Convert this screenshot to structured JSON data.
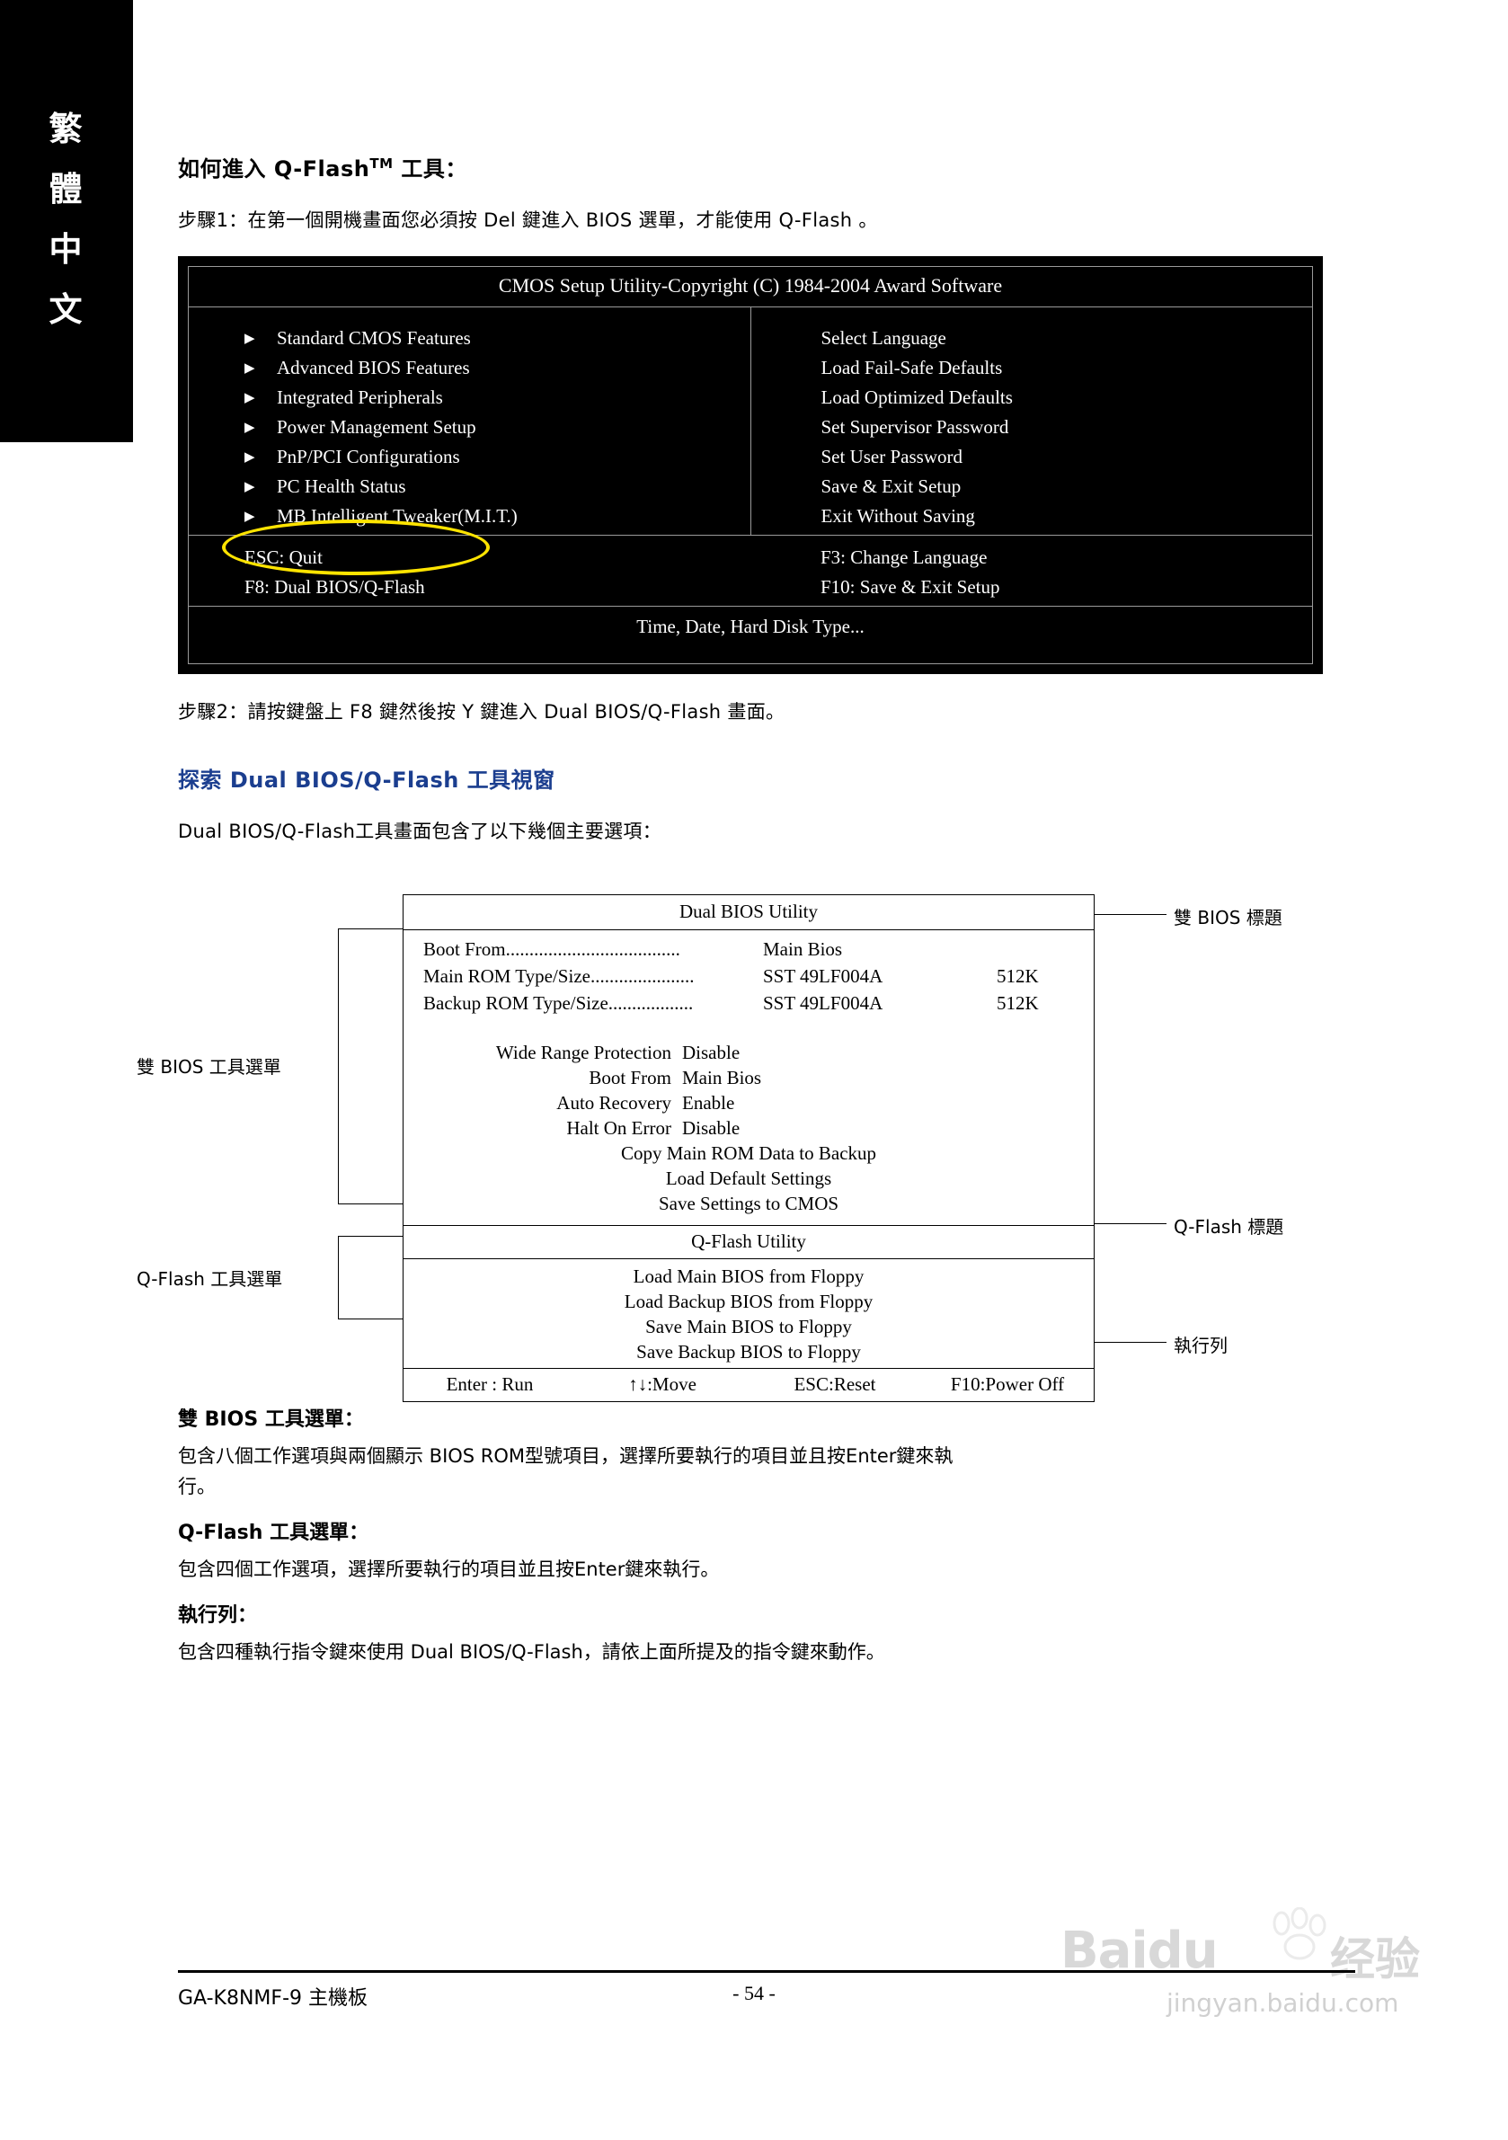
{
  "side_tab": {
    "chars": [
      "繁",
      "體",
      "中",
      "文"
    ]
  },
  "headings": {
    "how_to_enter": "如何進入 Q-Flash",
    "how_to_enter_sup": "TM",
    "how_to_enter_tail": " 工具：",
    "step1": "步驟1：在第一個開機畫面您必須按 Del 鍵進入 BIOS 選單，才能使用 Q-Flash 。",
    "step2": "步驟2：請按鍵盤上 F8 鍵然後按 Y 鍵進入 Dual BIOS/Q-Flash 畫面。",
    "explore": "探索 Dual BIOS/Q-Flash 工具視窗",
    "explore_desc": "Dual BIOS/Q-Flash工具畫面包含了以下幾個主要選項："
  },
  "bios_screen": {
    "title": "CMOS Setup Utility-Copyright (C) 1984-2004 Award Software",
    "left_items": [
      "Standard CMOS Features",
      "Advanced BIOS Features",
      "Integrated Peripherals",
      "Power Management Setup",
      "PnP/PCI Configurations",
      "PC Health Status",
      "MB Intelligent Tweaker(M.I.T.)"
    ],
    "right_items": [
      "Select Language",
      "Load Fail-Safe Defaults",
      "Load Optimized Defaults",
      "Set Supervisor Password",
      "Set User Password",
      "Save & Exit Setup",
      "Exit Without Saving"
    ],
    "keys_left": [
      "ESC: Quit",
      "F8: Dual BIOS/Q-Flash"
    ],
    "keys_right": [
      "F3: Change Language",
      "F10: Save & Exit Setup"
    ],
    "footer": "Time, Date, Hard Disk Type...",
    "highlight_color": "#ffe400"
  },
  "diagram": {
    "dual_title": "Dual BIOS Utility",
    "rom_rows": [
      {
        "label": "Boot From.....................................",
        "value": "Main Bios",
        "size": ""
      },
      {
        "label": "Main ROM Type/Size......................",
        "value": "SST 49LF004A",
        "size": "512K"
      },
      {
        "label": "Backup ROM Type/Size..................",
        "value": "SST 49LF004A",
        "size": "512K"
      }
    ],
    "options": [
      {
        "label": "Wide Range Protection",
        "value": "Disable"
      },
      {
        "label": "Boot From",
        "value": "Main Bios"
      },
      {
        "label": "Auto Recovery",
        "value": "Enable"
      },
      {
        "label": "Halt On Error",
        "value": "Disable"
      }
    ],
    "center_items": [
      "Copy Main ROM Data to Backup",
      "Load Default Settings",
      "Save Settings to CMOS"
    ],
    "qflash_title": "Q-Flash Utility",
    "qflash_items": [
      "Load Main BIOS from Floppy",
      "Load Backup BIOS from Floppy",
      "Save Main BIOS to Floppy",
      "Save Backup BIOS to Floppy"
    ],
    "bar_items": [
      "Enter : Run",
      "↑↓:Move",
      "ESC:Reset",
      "F10:Power Off"
    ],
    "callouts": {
      "dual_title_label": "雙 BIOS 標題",
      "dual_menu_label": "雙 BIOS 工具選單",
      "qflash_title_label": "Q-Flash 標題",
      "qflash_menu_label": "Q-Flash 工具選單",
      "bar_label": "執行列"
    }
  },
  "notes": {
    "dual_head": "雙 BIOS 工具選單：",
    "dual_body_1": "包含八個工作選項與兩個顯示 BIOS ROM型號項目，選擇所要執行的項目並且按Enter鍵來執",
    "dual_body_2": "行。",
    "qflash_head": "Q-Flash 工具選單：",
    "qflash_body": "包含四個工作選項，選擇所要執行的項目並且按Enter鍵來執行。",
    "bar_head": "執行列：",
    "bar_body": "包含四種執行指令鍵來使用 Dual BIOS/Q-Flash，請依上面所提及的指令鍵來動作。"
  },
  "footer": {
    "left": "GA-K8NMF-9 主機板",
    "center": "- 54 -"
  },
  "watermark": {
    "main": "Baidu",
    "cn": "经验",
    "sub": "jingyan.baidu.com"
  }
}
